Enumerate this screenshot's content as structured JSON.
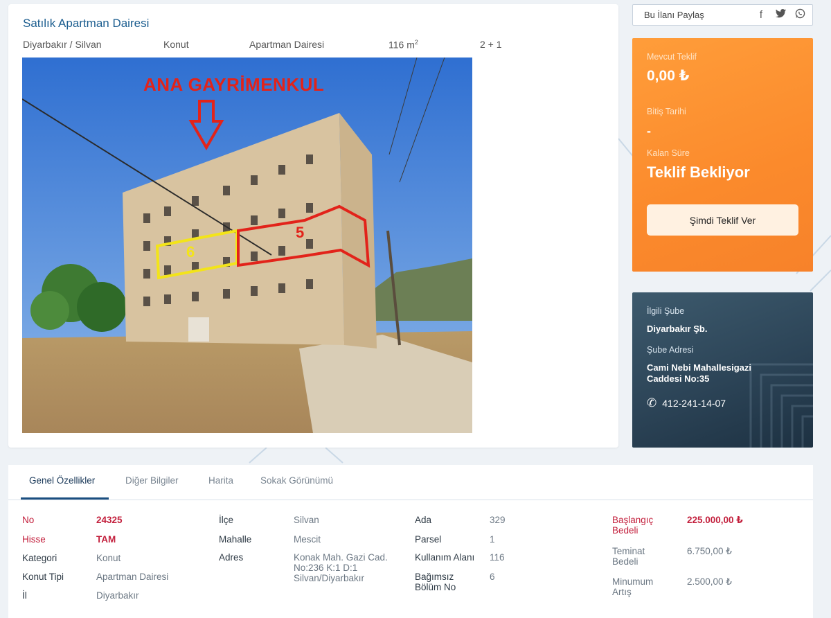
{
  "listing": {
    "title": "Satılık Apartman Dairesi",
    "location": "Diyarbakır / Silvan",
    "category": "Konut",
    "type": "Apartman Dairesi",
    "area_number": "116 m",
    "area_sup": "2",
    "rooms": "2 + 1"
  },
  "photo": {
    "headline": "ANA GAYRİMENKUL",
    "marker_yellow": "6",
    "marker_red": "5"
  },
  "share": {
    "label": "Bu İlanı Paylaş",
    "icons": [
      "facebook-icon",
      "twitter-icon",
      "whatsapp-icon"
    ]
  },
  "offer": {
    "current_label": "Mevcut Teklif",
    "current_value": "0,00 ₺",
    "end_label": "Bitiş Tarihi",
    "end_value": "-",
    "remaining_label": "Kalan Süre",
    "remaining_value": "Teklif Bekliyor",
    "button_label": "Şimdi Teklif Ver"
  },
  "branch": {
    "branch_label": "İlgili Şube",
    "branch_value": "Diyarbakır Şb.",
    "address_label": "Şube Adresi",
    "address_value": "Cami Nebi Mahallesigazi Caddesi No:35",
    "phone": "412-241-14-07"
  },
  "tabs": [
    {
      "label": "Genel Özellikler",
      "active": true
    },
    {
      "label": "Diğer Bilgiler",
      "active": false
    },
    {
      "label": "Harita",
      "active": false
    },
    {
      "label": "Sokak Görünümü",
      "active": false
    }
  ],
  "details": {
    "col1": [
      {
        "key": "No",
        "value": "24325"
      },
      {
        "key": "Hisse",
        "value": "TAM"
      },
      {
        "key": "Kategori",
        "value": "Konut"
      },
      {
        "key": "Konut Tipi",
        "value": "Apartman Dairesi"
      },
      {
        "key": "İl",
        "value": "Diyarbakır"
      }
    ],
    "col2": [
      {
        "key": "İlçe",
        "value": "Silvan"
      },
      {
        "key": "Mahalle",
        "value": "Mescit"
      },
      {
        "key": "Adres",
        "value": "Konak Mah. Gazi Cad. No:236 K:1 D:1 Silvan/Diyarbakır"
      }
    ],
    "col3": [
      {
        "key": "Ada",
        "value": "329"
      },
      {
        "key": "Parsel",
        "value": "1"
      },
      {
        "key": "Kullanım Alanı",
        "value": "116"
      },
      {
        "key": "Bağımsız Bölüm No",
        "value": "6"
      }
    ],
    "col4": [
      {
        "key": "Başlangıç Bedeli",
        "value": "225.000,00 ₺"
      },
      {
        "key": "Teminat Bedeli",
        "value": "6.750,00 ₺"
      },
      {
        "key": "Minumum Artış",
        "value": "2.500,00 ₺"
      }
    ]
  },
  "colors": {
    "title_blue": "#1b5d8f",
    "offer_orange": "#fb8a2c",
    "branch_navy": "#2c4457",
    "red_accent": "#c3203d"
  }
}
